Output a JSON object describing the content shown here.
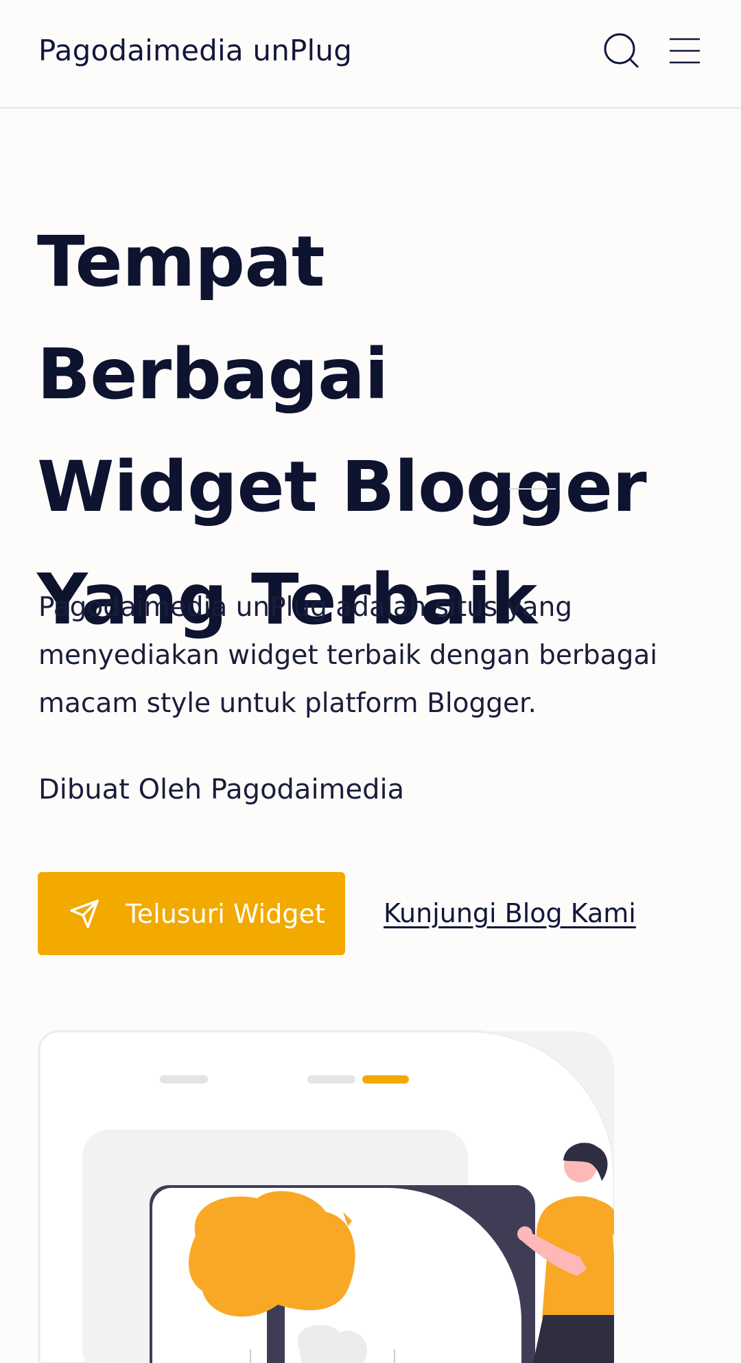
{
  "header": {
    "brand": "Pagodaimedia unPlug",
    "search_icon": "search-icon",
    "menu_icon": "hamburger-menu-icon"
  },
  "hero": {
    "title_line1": "Tempat Berbagai",
    "title_line2": "Widget Blogger",
    "title_line3": "Yang Terbaik",
    "description": "Pagodaimedia unPlug adalah situs yang menyediakan widget terbaik dengan berbagai macam style untuk platform Blogger.",
    "credit": "Dibuat Oleh Pagodaimedia",
    "primary_button": {
      "label": "Telusuri Widget",
      "icon": "send-icon"
    },
    "secondary_link": "Kunjungi Blog Kami"
  },
  "colors": {
    "accent": "#f2a900",
    "text": "#0e1330",
    "background": "#fdfcfb",
    "illustration_dark": "#3f3d56",
    "illustration_orange": "#f9a826"
  }
}
